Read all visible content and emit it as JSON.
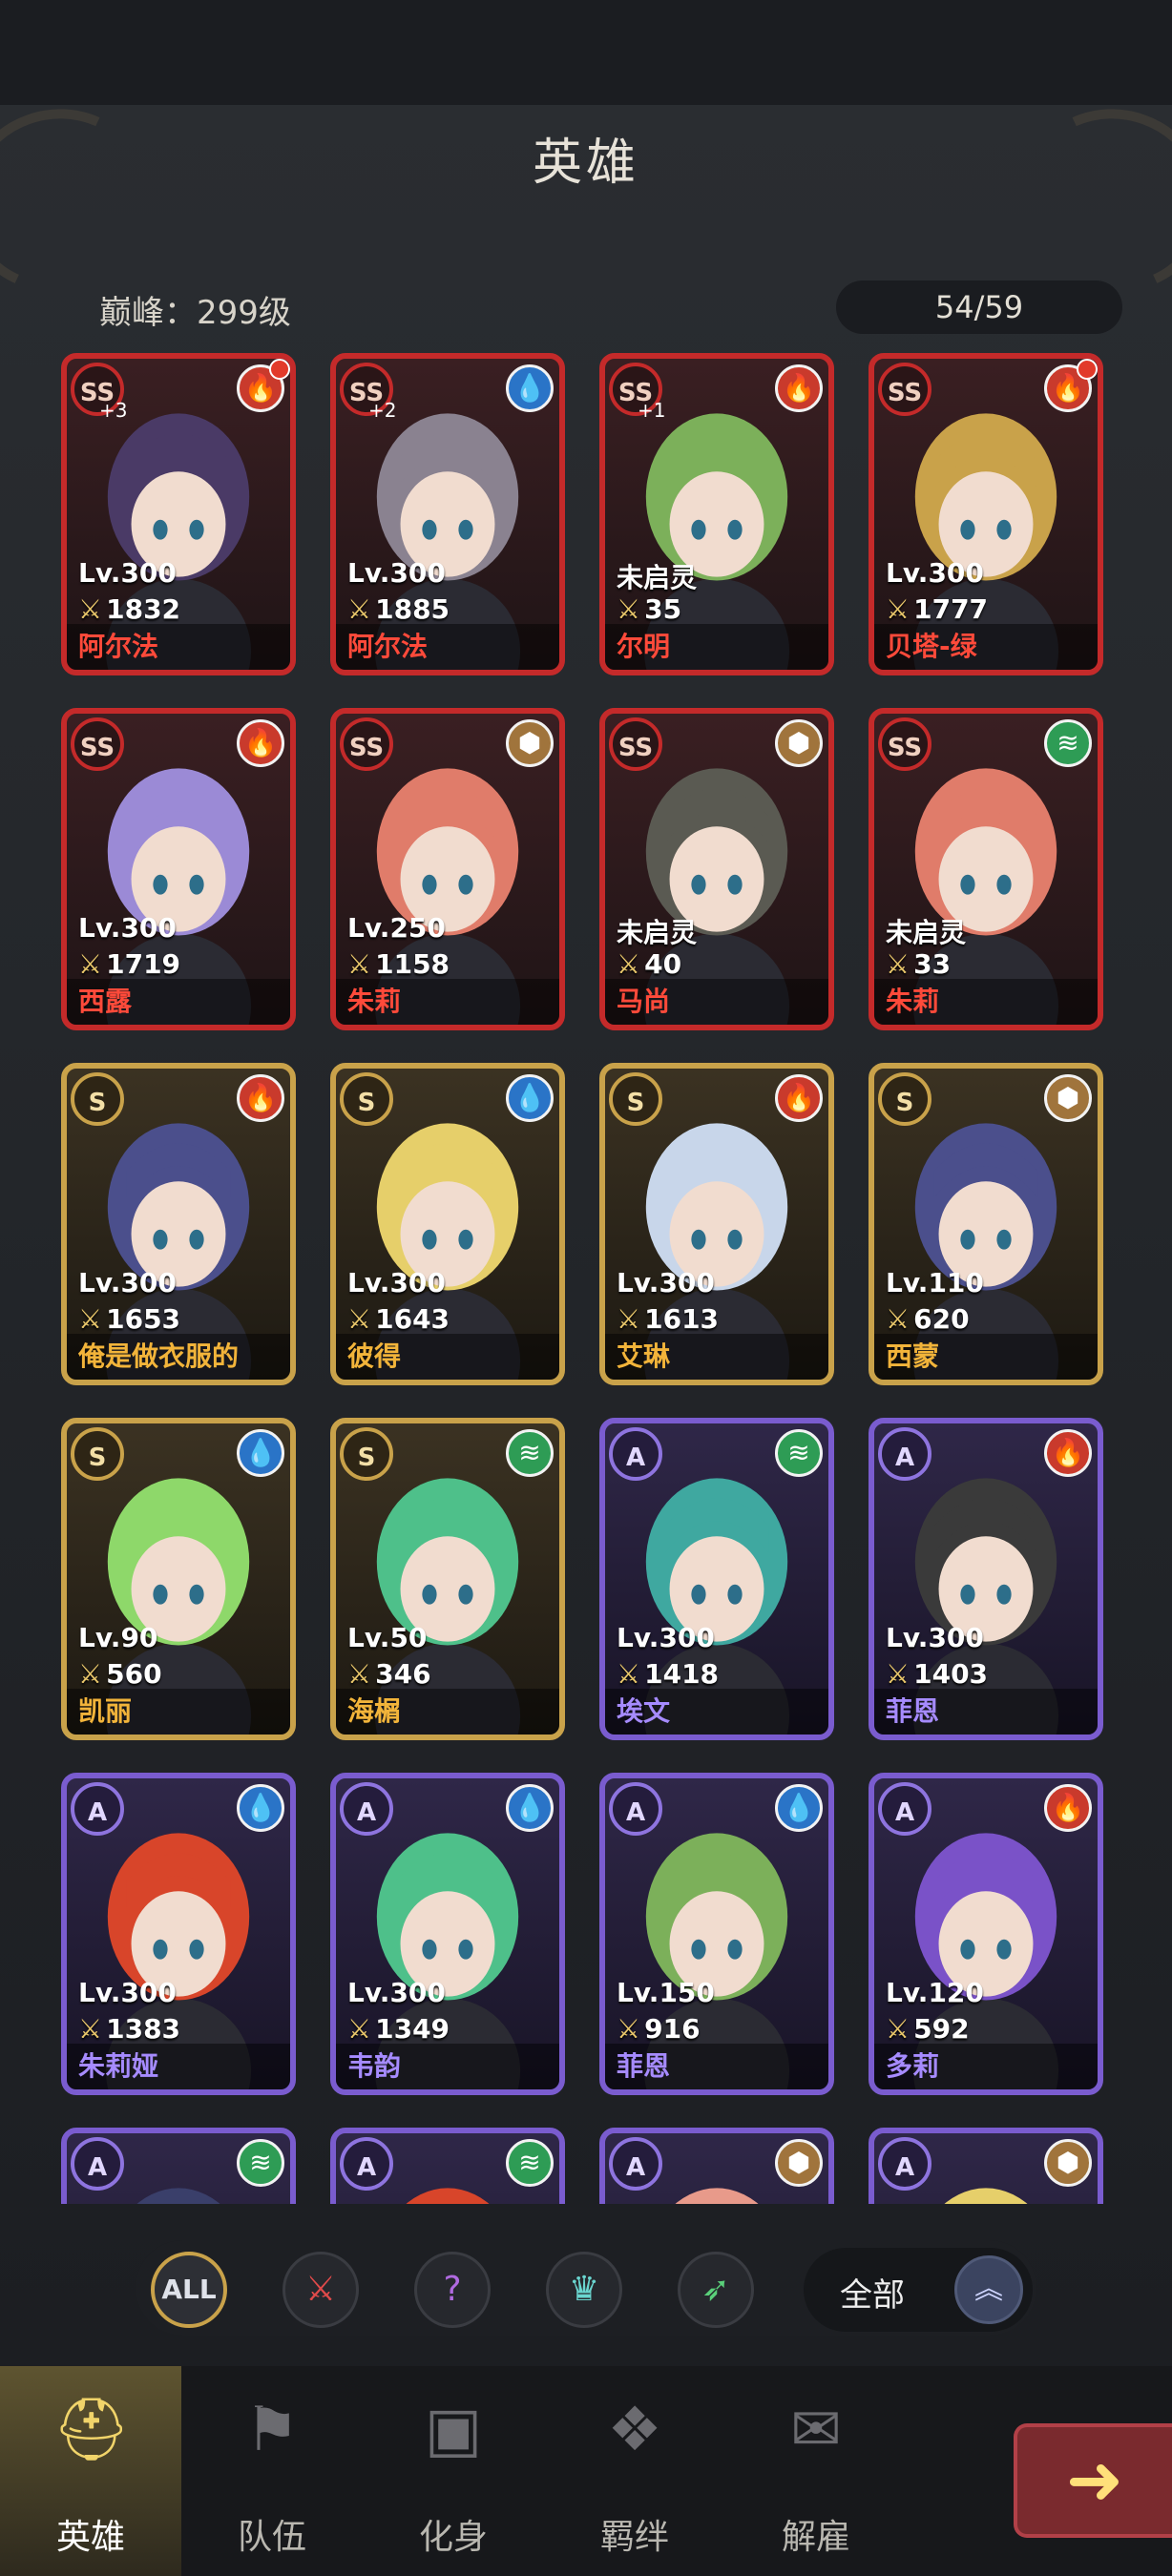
{
  "header": {
    "title": "英雄",
    "peak": "巅峰：299级",
    "count": "54/59"
  },
  "heroes": [
    {
      "rank": "SS",
      "plus": "+3",
      "element": "fire",
      "dot": true,
      "level": "Lv.300",
      "power": "1832",
      "name": "阿尔法",
      "hair": "#4a3a66"
    },
    {
      "rank": "SS",
      "plus": "+2",
      "element": "water",
      "dot": false,
      "level": "Lv.300",
      "power": "1885",
      "name": "阿尔法",
      "hair": "#8a8290"
    },
    {
      "rank": "SS",
      "plus": "+1",
      "element": "fire",
      "dot": false,
      "level": "未启灵",
      "power": "35",
      "name": "尔明",
      "hair": "#7cb05a"
    },
    {
      "rank": "SS",
      "plus": "",
      "element": "fire",
      "dot": true,
      "level": "Lv.300",
      "power": "1777",
      "name": "贝塔-绿",
      "hair": "#c9a24a"
    },
    {
      "rank": "SS",
      "plus": "",
      "element": "fire",
      "dot": false,
      "level": "Lv.300",
      "power": "1719",
      "name": "西露",
      "hair": "#9b8ad6"
    },
    {
      "rank": "SS",
      "plus": "",
      "element": "earth",
      "dot": false,
      "level": "Lv.250",
      "power": "1158",
      "name": "朱莉",
      "hair": "#e07c6a"
    },
    {
      "rank": "SS",
      "plus": "",
      "element": "earth",
      "dot": false,
      "level": "未启灵",
      "power": "40",
      "name": "马尚",
      "hair": "#5a5a52"
    },
    {
      "rank": "SS",
      "plus": "",
      "element": "wind",
      "dot": false,
      "level": "未启灵",
      "power": "33",
      "name": "朱莉",
      "hair": "#e07c6a"
    },
    {
      "rank": "S",
      "plus": "",
      "element": "fire",
      "dot": false,
      "level": "Lv.300",
      "power": "1653",
      "name": "俺是做衣服的",
      "hair": "#4b4f8c"
    },
    {
      "rank": "S",
      "plus": "",
      "element": "water",
      "dot": false,
      "level": "Lv.300",
      "power": "1643",
      "name": "彼得",
      "hair": "#e6cf6a"
    },
    {
      "rank": "S",
      "plus": "",
      "element": "fire",
      "dot": false,
      "level": "Lv.300",
      "power": "1613",
      "name": "艾琳",
      "hair": "#c8d6ea"
    },
    {
      "rank": "S",
      "plus": "",
      "element": "earth",
      "dot": false,
      "level": "Lv.110",
      "power": "620",
      "name": "西蒙",
      "hair": "#4b4f8c"
    },
    {
      "rank": "S",
      "plus": "",
      "element": "water",
      "dot": false,
      "level": "Lv.90",
      "power": "560",
      "name": "凯丽",
      "hair": "#8ed86a"
    },
    {
      "rank": "S",
      "plus": "",
      "element": "wind",
      "dot": false,
      "level": "Lv.50",
      "power": "346",
      "name": "海榍",
      "hair": "#4ec08a"
    },
    {
      "rank": "A",
      "plus": "",
      "element": "wind",
      "dot": false,
      "level": "Lv.300",
      "power": "1418",
      "name": "埃文",
      "hair": "#3fa8a0"
    },
    {
      "rank": "A",
      "plus": "",
      "element": "fire",
      "dot": false,
      "level": "Lv.300",
      "power": "1403",
      "name": "菲恩",
      "hair": "#3a3a3a"
    },
    {
      "rank": "A",
      "plus": "",
      "element": "water",
      "dot": false,
      "level": "Lv.300",
      "power": "1383",
      "name": "朱莉娅",
      "hair": "#d8452a"
    },
    {
      "rank": "A",
      "plus": "",
      "element": "water",
      "dot": false,
      "level": "Lv.300",
      "power": "1349",
      "name": "韦韵",
      "hair": "#4ec08a"
    },
    {
      "rank": "A",
      "plus": "",
      "element": "water",
      "dot": false,
      "level": "Lv.150",
      "power": "916",
      "name": "菲恩",
      "hair": "#7cb05a"
    },
    {
      "rank": "A",
      "plus": "",
      "element": "fire",
      "dot": false,
      "level": "Lv.120",
      "power": "592",
      "name": "多莉",
      "hair": "#7a52c8"
    },
    {
      "rank": "A",
      "plus": "",
      "element": "wind",
      "dot": false,
      "level": "",
      "power": "",
      "name": "",
      "hair": "#3a3f6a"
    },
    {
      "rank": "A",
      "plus": "",
      "element": "wind",
      "dot": false,
      "level": "",
      "power": "",
      "name": "",
      "hair": "#d8452a"
    },
    {
      "rank": "A",
      "plus": "",
      "element": "earth",
      "dot": false,
      "level": "",
      "power": "",
      "name": "",
      "hair": "#e89a8a"
    },
    {
      "rank": "A",
      "plus": "",
      "element": "earth",
      "dot": false,
      "level": "",
      "power": "",
      "name": "",
      "hair": "#e6cf6a"
    }
  ],
  "filters": {
    "all_label": "ALL",
    "roles": [
      "sword-icon",
      "mystery-icon",
      "crown-icon",
      "bow-icon"
    ],
    "select_label": "全部"
  },
  "nav": [
    {
      "label": "英雄",
      "icon": "helmet-icon",
      "active": true
    },
    {
      "label": "队伍",
      "icon": "flag-icon",
      "active": false
    },
    {
      "label": "化身",
      "icon": "cards-icon",
      "active": false
    },
    {
      "label": "羁绊",
      "icon": "bond-icon",
      "active": false
    },
    {
      "label": "解雇",
      "icon": "scroll-icon",
      "active": false
    }
  ],
  "colors": {
    "ss": "#c42a2a",
    "s": "#c9a24a",
    "a": "#7a5ccf",
    "fire": "#c93a2c",
    "water": "#2a74c7",
    "earth": "#a0743c",
    "wind": "#2e9c55"
  }
}
